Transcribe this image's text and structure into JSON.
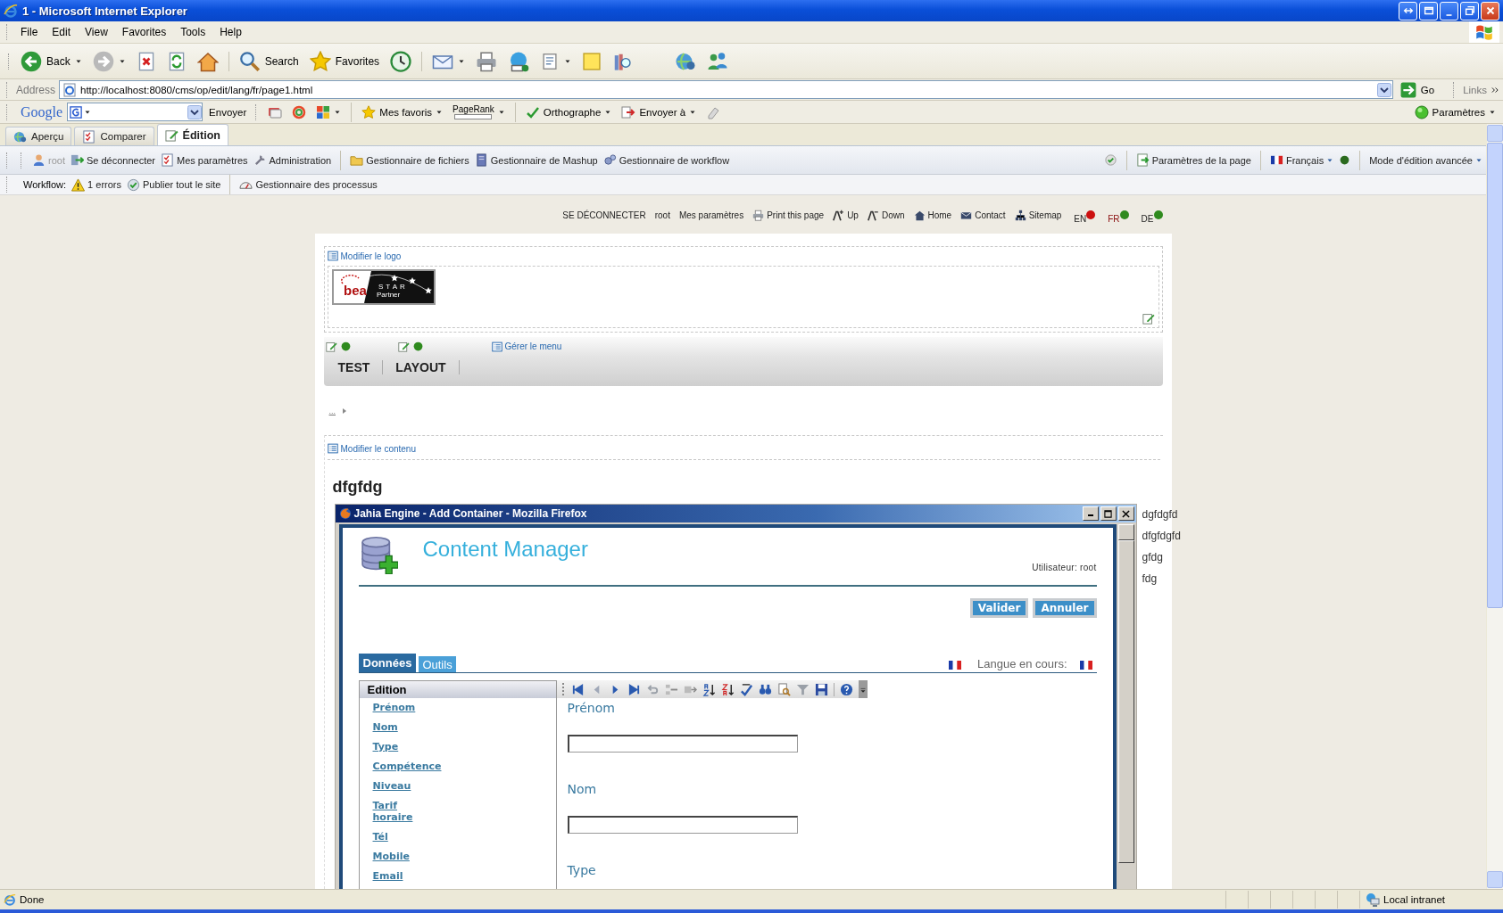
{
  "window": {
    "title": "1 - Microsoft Internet Explorer"
  },
  "menu": [
    "File",
    "Edit",
    "View",
    "Favorites",
    "Tools",
    "Help"
  ],
  "toolbar": {
    "back": "Back",
    "search": "Search",
    "favorites": "Favorites"
  },
  "address_bar": {
    "label": "Address",
    "value": "http://localhost:8080/cms/op/edit/lang/fr/page1.html",
    "go": "Go",
    "links": "Links"
  },
  "google_bar": {
    "logo": "Google",
    "send": "Envoyer",
    "favorites": "Mes favoris",
    "pagerank": "PageRank",
    "spelling": "Orthographe",
    "send_to": "Envoyer à",
    "settings": "Paramètres"
  },
  "mode_tabs": [
    {
      "label": "Aperçu",
      "selected": false
    },
    {
      "label": "Comparer",
      "selected": false
    },
    {
      "label": "Édition",
      "selected": true
    }
  ],
  "jahia_toolbar": {
    "items": [
      {
        "label": "root",
        "disabled": true
      },
      {
        "label": "Se déconnecter",
        "disabled": false
      },
      {
        "label": "Mes paramètres",
        "disabled": false
      },
      {
        "label": "Administration",
        "disabled": false
      },
      {
        "label": "Gestionnaire de fichiers",
        "disabled": false
      },
      {
        "label": "Gestionnaire de Mashup",
        "disabled": false
      },
      {
        "label": "Gestionnaire de workflow",
        "disabled": false
      }
    ],
    "page_settings": "Paramètres de la page",
    "language": "Français",
    "mode": "Mode d'édition avancée"
  },
  "workflow_bar": {
    "label": "Workflow:",
    "errors": "1 errors",
    "publish": "Publier tout le site",
    "processes": "Gestionnaire des processus"
  },
  "top_links": {
    "items": [
      "SE DÉCONNECTER",
      "root",
      "Mes paramètres",
      "Print this page",
      "Up",
      "Down",
      "Home",
      "Contact",
      "Sitemap"
    ],
    "languages": [
      {
        "code": "EN",
        "selected": false,
        "color": "#cc1010"
      },
      {
        "code": "FR",
        "selected": true,
        "color": "#2f8a1e"
      },
      {
        "code": "DE",
        "selected": false,
        "color": "#2f8a1e"
      }
    ]
  },
  "logo_area": {
    "edit_link": "Modifier le logo",
    "logo": {
      "brand": "bea",
      "line1": "STAR",
      "line2": "Partner"
    }
  },
  "menu_area": {
    "manage_link": "Gérer le menu",
    "items": [
      "TEST",
      "LAYOUT"
    ]
  },
  "breadcrumb": "...",
  "content_area": {
    "edit_link": "Modifier le contenu",
    "heading": "dfgfdg",
    "side_items": [
      "dgfdgfd",
      "dfgfdgfd",
      "gfdg",
      "fdg"
    ]
  },
  "popup": {
    "title": "Jahia Engine - Add Container - Mozilla Firefox",
    "header": "Content Manager",
    "user": "Utilisateur: root",
    "buttons": [
      "Valider",
      "Annuler"
    ],
    "tabs": [
      {
        "label": "Données",
        "selected": true
      },
      {
        "label": "Outils",
        "selected": false
      }
    ],
    "language_label": "Langue en cours:",
    "panel_title": "Edition",
    "panel_links": [
      "Prénom",
      "Nom",
      "Type",
      "Compétence",
      "Niveau",
      "Tarif horaire",
      "Tél",
      "Mobile",
      "Email"
    ],
    "fields": [
      {
        "label": "Prénom",
        "input": true
      },
      {
        "label": "Nom",
        "input": true
      },
      {
        "label": "Type",
        "input": false
      }
    ]
  },
  "status_bar": {
    "text": "Done",
    "zone": "Local intranet"
  }
}
